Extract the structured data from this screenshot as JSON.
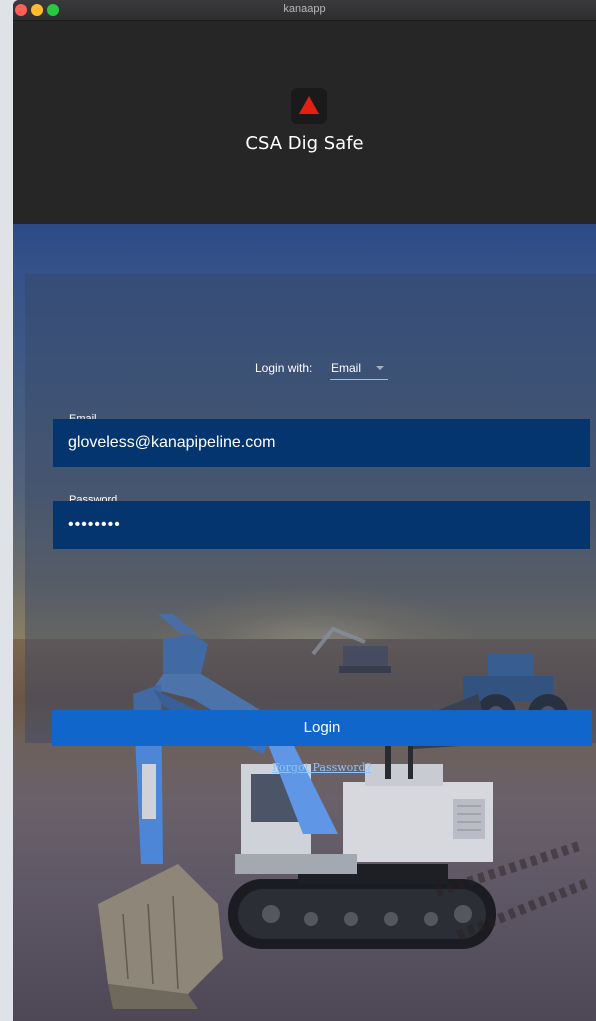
{
  "window": {
    "title": "kanaapp"
  },
  "header": {
    "app_title": "CSA Dig Safe",
    "logo_icon": "red-triangle-icon",
    "logo_color": "#e41f14"
  },
  "login": {
    "login_with_label": "Login with:",
    "method_selected": "Email",
    "email_label": "Email",
    "email_value": "gloveless@kanapipeline.com",
    "password_label": "Password",
    "password_value": "••••••••",
    "login_button": "Login",
    "forgot_password": "Forgot Password?"
  },
  "colors": {
    "accent": "#1166cc",
    "field_bg": "#05356e",
    "link": "#8cc4ff"
  }
}
